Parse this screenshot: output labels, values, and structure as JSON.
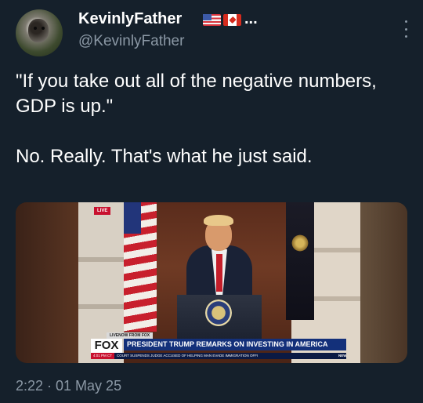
{
  "author": {
    "display_name": "KevinlyFather",
    "name_ellipsis": "...",
    "handle": "@KevinlyFather",
    "flag_icons": [
      "us-flag-icon",
      "canada-flag-icon"
    ]
  },
  "tweet": {
    "paragraphs": [
      "\"If you take out all of the negative numbers, GDP is up.\"",
      "No. Really. That's what he just said."
    ],
    "timestamp": "2:22 · 01 May 25"
  },
  "media": {
    "live_label": "LIVE",
    "ticker_top": "LIVENOW FROM FOX",
    "network": "FOX",
    "headline": "PRESIDENT TRUMP REMARKS ON INVESTING IN AMERICA",
    "ticker_time": "4:01 PM CT",
    "ticker_text": "COURT SUSPENDS JUDGE ACCUSED OF HELPING MAN EVADE IMMIGRATION OFFI",
    "news_tag": "NEWS"
  },
  "colors": {
    "background": "#15202b",
    "secondary_text": "#8b98a5",
    "headline_bar": "#13307a"
  }
}
